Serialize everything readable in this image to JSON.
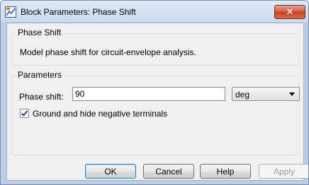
{
  "window": {
    "title": "Block Parameters: Phase Shift",
    "close_symbol": "✕"
  },
  "description_group": {
    "title": "Phase Shift",
    "text": "Model phase shift for circuit-envelope analysis."
  },
  "parameters_group": {
    "title": "Parameters",
    "phase_shift": {
      "label": "Phase shift:",
      "value": "90",
      "unit": "deg"
    },
    "ground_checkbox": {
      "label": "Ground and hide negative terminals",
      "checked": true
    }
  },
  "buttons": {
    "ok": "OK",
    "cancel": "Cancel",
    "help": "Help",
    "apply": "Apply"
  },
  "colors": {
    "title_bar": "#c9dbee",
    "close_button": "#c2401f",
    "dialog_bg": "#f0f0f0",
    "check_mark": "#26477a",
    "default_button_border": "#3c7fb1"
  },
  "icons": {
    "app": "simulink-block-icon",
    "close": "close-icon",
    "dropdown": "chevron-down-icon",
    "check": "check-mark-icon"
  }
}
